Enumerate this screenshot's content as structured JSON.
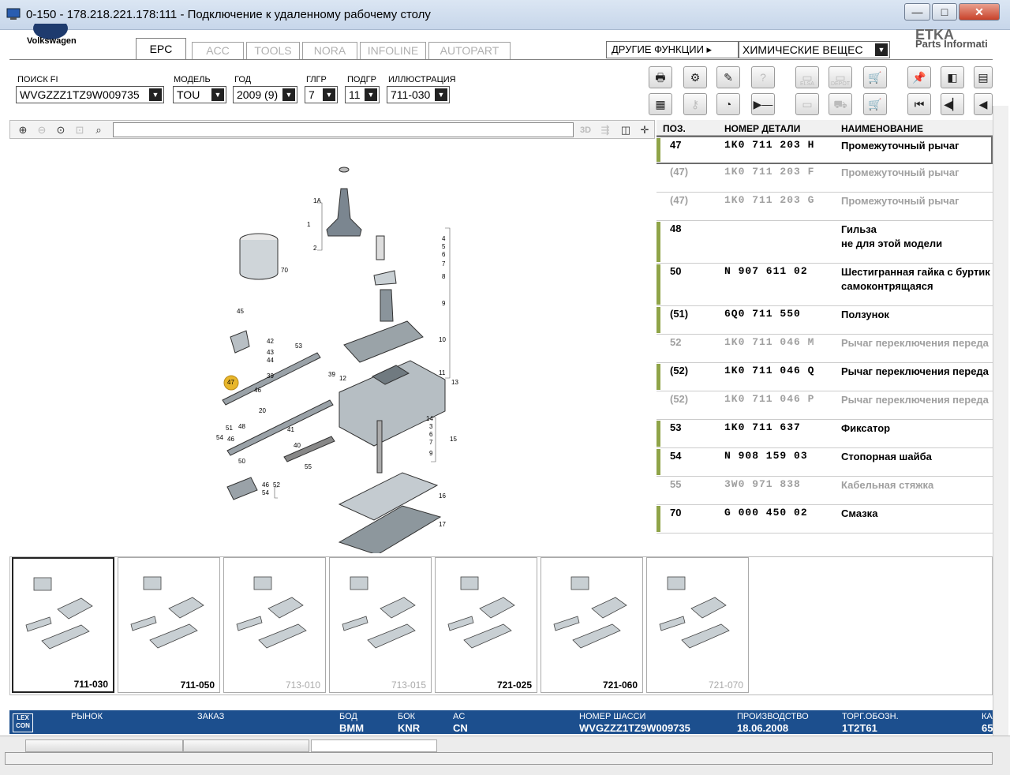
{
  "window": {
    "title": "0-150 - 178.218.221.178:111 - Подключение к удаленному рабочему столу",
    "min": "—",
    "max": "□",
    "close": "✕"
  },
  "brand": {
    "label": "Volkswagen",
    "right_top": "ETKA",
    "right_label": "Parts Informati"
  },
  "tabs": [
    {
      "label": "EPC",
      "active": true
    },
    {
      "label": "ACC"
    },
    {
      "label": "TOOLS"
    },
    {
      "label": "NORA"
    },
    {
      "label": "INFOLINE"
    },
    {
      "label": "AUTOPART"
    }
  ],
  "other_functions": "ДРУГИЕ ФУНКЦИИ ▸",
  "chemicals": "ХИМИЧЕСКИЕ ВЕЩЕС",
  "fields": {
    "search_fi": {
      "label": "ПОИСК FI",
      "value": "WVGZZZ1TZ9W009735"
    },
    "model": {
      "label": "МОДЕЛЬ",
      "value": "TOU"
    },
    "year": {
      "label": "ГОД",
      "value": "2009 (9)"
    },
    "mg": {
      "label": "ГЛГР",
      "value": "7"
    },
    "sg": {
      "label": "ПОДГР",
      "value": "11"
    },
    "illustration": {
      "label": "ИЛЛЮСТРАЦИЯ",
      "value": "711-030"
    }
  },
  "toolbar": {
    "elsa": "ELSA",
    "depot": "DEPOT"
  },
  "zoom": {
    "threed": "3D"
  },
  "parts": {
    "headers": {
      "pos": "ПОЗ.",
      "number": "НОМЕР ДЕТАЛИ",
      "name": "НАИМЕНОВАНИЕ"
    },
    "rows": [
      {
        "pos": "47",
        "number": "1K0 711 203 H",
        "name": "Промежуточный рычаг",
        "name2": "",
        "style": "sel"
      },
      {
        "pos": "(47)",
        "number": "1K0 711 203 F",
        "name": "Промежуточный рычаг",
        "name2": "",
        "style": "gray"
      },
      {
        "pos": "(47)",
        "number": "1K0 711 203 G",
        "name": "Промежуточный рычаг",
        "name2": "",
        "style": "gray"
      },
      {
        "pos": "48",
        "number": "",
        "name": "Гильза",
        "name2": "не для этой модели",
        "style": "ok"
      },
      {
        "pos": "50",
        "number": "N   907 611 02",
        "name": "Шестигранная гайка с буртик",
        "name2": "самоконтрящаяся",
        "style": "ok"
      },
      {
        "pos": "(51)",
        "number": "6Q0 711 550",
        "name": "Ползунок",
        "name2": "",
        "style": "ok"
      },
      {
        "pos": "52",
        "number": "1K0 711 046 M",
        "name": "Рычаг переключения переда",
        "name2": "",
        "style": "gray"
      },
      {
        "pos": "(52)",
        "number": "1K0 711 046 Q",
        "name": "Рычаг переключения переда",
        "name2": "",
        "style": "ok"
      },
      {
        "pos": "(52)",
        "number": "1K0 711 046 P",
        "name": "Рычаг переключения переда",
        "name2": "",
        "style": "gray"
      },
      {
        "pos": "53",
        "number": "1K0 711 637",
        "name": "Фиксатор",
        "name2": "",
        "style": "ok"
      },
      {
        "pos": "54",
        "number": "N   908 159 03",
        "name": "Стопорная шайба",
        "name2": "",
        "style": "ok"
      },
      {
        "pos": "55",
        "number": "3W0 971 838",
        "name": "Кабельная стяжка",
        "name2": "",
        "style": "gray"
      },
      {
        "pos": "70",
        "number": "G   000 450 02",
        "name": "Смазка",
        "name2": "",
        "style": "ok"
      }
    ]
  },
  "diagram_labels": [
    "1A",
    "1",
    "2",
    "70",
    "45",
    "42",
    "43",
    "44",
    "53",
    "39",
    "47",
    "46",
    "20",
    "48",
    "51",
    "54",
    "46",
    "50",
    "41",
    "40",
    "39",
    "12",
    "55",
    "46",
    "54",
    "52",
    "4",
    "5",
    "6",
    "7",
    "8",
    "9",
    "10",
    "11",
    "13",
    "14",
    "15",
    "16",
    "17",
    "3",
    "6",
    "7",
    "9"
  ],
  "thumbnails": [
    {
      "label": "711-030",
      "selected": true,
      "dim": false
    },
    {
      "label": "711-050",
      "selected": false,
      "dim": false
    },
    {
      "label": "713-010",
      "selected": false,
      "dim": true
    },
    {
      "label": "713-015",
      "selected": false,
      "dim": true
    },
    {
      "label": "721-025",
      "selected": false,
      "dim": false
    },
    {
      "label": "721-060",
      "selected": false,
      "dim": false
    },
    {
      "label": "721-070",
      "selected": false,
      "dim": true
    }
  ],
  "status": {
    "lex": "LEX CON",
    "market_label": "РЫНОК",
    "order_label": "ЗАКАЗ",
    "body_label": "БОД",
    "body_value": "BMM",
    "box_label": "БОК",
    "box_value": "KNR",
    "ac_label": "AC",
    "ac_value": "CN",
    "chassis_label": "НОМЕР ШАССИ",
    "chassis_value": "WVGZZZ1TZ9W009735",
    "prod_label": "ПРОИЗВОДСТВО",
    "prod_value": "18.06.2008",
    "trade_label": "ТОРГ.ОБОЗН.",
    "trade_value": "1T2T61",
    "extra_label": "КА",
    "extra_value": "65"
  },
  "colors": {
    "status_bg": "#1c4f8e",
    "ok_bar": "#8fa448",
    "highlight": "#e8b62b"
  }
}
